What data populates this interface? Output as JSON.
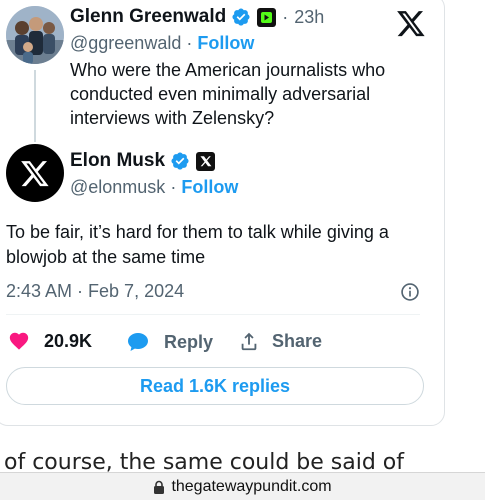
{
  "quoted_tweet": {
    "name": "Glenn Greenwald",
    "time": "23h",
    "handle": "@ggreenwald",
    "follow": "Follow",
    "text": "Who were the American journalists who conducted even minimally adversarial interviews with Zelensky?"
  },
  "tweet": {
    "name": "Elon Musk",
    "handle": "@elonmusk",
    "follow": "Follow",
    "text": "To be fair, it’s hard for them to talk while giving a blowjob at the same time",
    "timestamp": "2:43 AM · Feb 7, 2024"
  },
  "actions": {
    "likes": "20.9K",
    "reply": "Reply",
    "share": "Share"
  },
  "read_replies": "Read 1.6K replies",
  "article_text": "of course, the same could be said of",
  "browser": {
    "url": "thegatewaypundit.com"
  },
  "colors": {
    "accent": "#1d9bf0",
    "like": "#f91880",
    "muted": "#536471"
  },
  "separator": "·"
}
